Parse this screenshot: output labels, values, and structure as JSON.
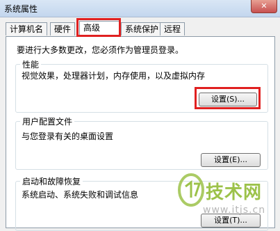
{
  "window": {
    "title": "系统属性",
    "close_glyph": "✕"
  },
  "tabs": [
    {
      "label": "计算机名",
      "active": false
    },
    {
      "label": "硬件",
      "active": false
    },
    {
      "label": "高级",
      "active": true
    },
    {
      "label": "系统保护",
      "active": false
    },
    {
      "label": "远程",
      "active": false
    }
  ],
  "admin_note": "要进行大多数更改，您必须作为管理员登录。",
  "performance": {
    "label": "性能",
    "description": "视觉效果，处理器计划，内存使用，以及虚拟内存",
    "button": "设置(S)..."
  },
  "user_profiles": {
    "label": "用户配置文件",
    "description": "与您登录有关的桌面设置",
    "button": "设置(E)..."
  },
  "startup_recovery": {
    "label": "启动和故障恢复",
    "description": "系统启动、系统失败和调试信息",
    "button": "设置(T)..."
  },
  "watermark": {
    "text": "技术网",
    "url": "www.itjs.cn"
  },
  "colors": {
    "highlight": "#e02020",
    "watermark_green": "#9cc24a"
  }
}
